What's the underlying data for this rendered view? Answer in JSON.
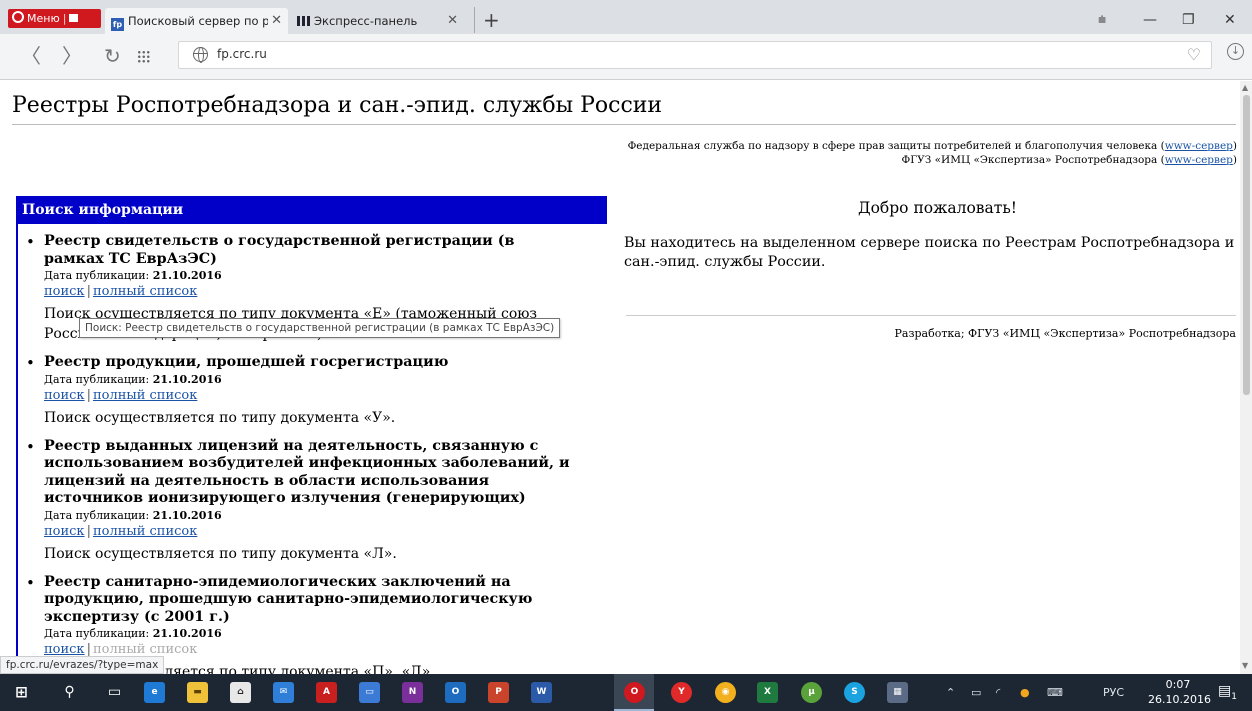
{
  "browser": {
    "menu_label": "Меню",
    "tabs": [
      {
        "title": "Поисковый сервер по реестрам Роспотребнадзора",
        "favicon": "fp"
      },
      {
        "title": "Экспресс-панель"
      }
    ],
    "url": "fp.crc.ru"
  },
  "page": {
    "title": "Реестры Роспотребнадзора и сан.-эпид. службы России",
    "fed_service": "Федеральная служба по надзору в сфере прав защиты потребителей и благополучия человека",
    "fguz": "ФГУЗ «ИМЦ «Экспертиза» Роспотребнадзора",
    "www_link": "www-сервер",
    "search_heading": "Поиск информации",
    "date_label": "Дата публикации:",
    "search_label": "поиск",
    "full_list_label": "полный список",
    "registries": [
      {
        "title": "Реестр свидетельств о государственной регистрации (в рамках ТС ЕврАзЭС)",
        "date": "21.10.2016",
        "note": "Поиск осуществляется по типу документа «Е» (таможенный союз Российской Федерации, номера RU.*)."
      },
      {
        "title": "Реестр продукции, прошедшей госрегистрацию",
        "date": "21.10.2016",
        "note": "Поиск осуществляется по типу документа «У»."
      },
      {
        "title": "Реестр выданных лицензий на деятельность, связанную с использованием возбудителей инфекционных заболеваний, и лицензий на деятельность в области использования источников ионизирующего излучения (генерирующих)",
        "date": "21.10.2016",
        "note": "Поиск осуществляется по типу документа «Л»."
      },
      {
        "title": "Реестр санитарно-эпидемиологических заключений на продукцию, прошедшую санитарно-эпидемиологическую экспертизу (с 2001 г.)",
        "date": "21.10.2016",
        "note": "Поиск осуществляется по типу документа «П», «Д»."
      }
    ],
    "welcome_title": "Добро пожаловать!",
    "welcome_text": "Вы находитесь на выделенном сервере поиска по Реестрам Роспотребнадзора и сан.-эпид. службы России.",
    "developer": "Разработка; ФГУЗ «ИМЦ «Экспертиза» Роспотребнадзора",
    "tooltip": "Поиск: Реестр свидетельств о государственной регистрации (в рамках ТС ЕврАзЭС)",
    "status_url": "fp.crc.ru/evrazes/?type=max"
  },
  "taskbar": {
    "lang": "РУС",
    "time": "0:07",
    "date": "26.10.2016",
    "notifications": "1"
  }
}
